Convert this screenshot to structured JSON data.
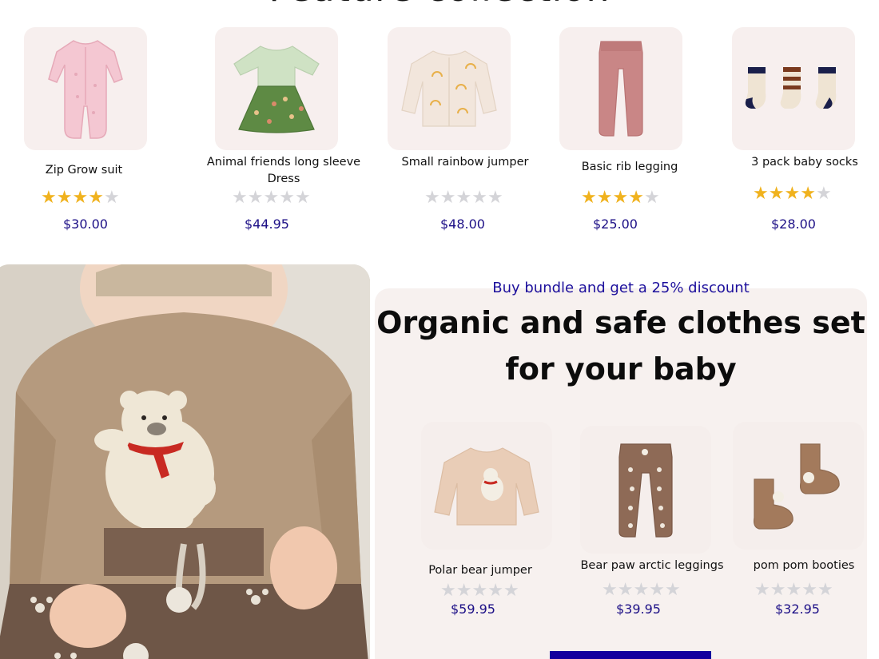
{
  "section": {
    "title": "Feature collection"
  },
  "products": [
    {
      "name": "Zip Grow suit",
      "rating": 4,
      "price": "$30.00"
    },
    {
      "name": "Animal friends long sleeve",
      "name2": "Dress",
      "rating": 0,
      "price": "$44.95"
    },
    {
      "name": "Small rainbow jumper",
      "rating": 0,
      "price": "$48.00"
    },
    {
      "name": "Basic rib legging",
      "rating": 4,
      "price": "$25.00"
    },
    {
      "name": "3 pack baby socks",
      "rating": 4,
      "price": "$28.00"
    }
  ],
  "bundle": {
    "kicker": "Buy bundle and get a 25% discount",
    "title_line1": "Organic and safe clothes set",
    "title_line2": "for your baby",
    "items": [
      {
        "name": "Polar bear jumper",
        "rating": 0,
        "price": "$59.95"
      },
      {
        "name": "Bear paw arctic leggings",
        "rating": 0,
        "price": "$39.95"
      },
      {
        "name": "pom pom booties",
        "rating": 0,
        "price": "$32.95"
      }
    ]
  },
  "colors": {
    "accent": "#1c0f86",
    "star_on": "#f0b21e",
    "star_off": "#d4d4d8",
    "card_bg": "#f7efee"
  }
}
